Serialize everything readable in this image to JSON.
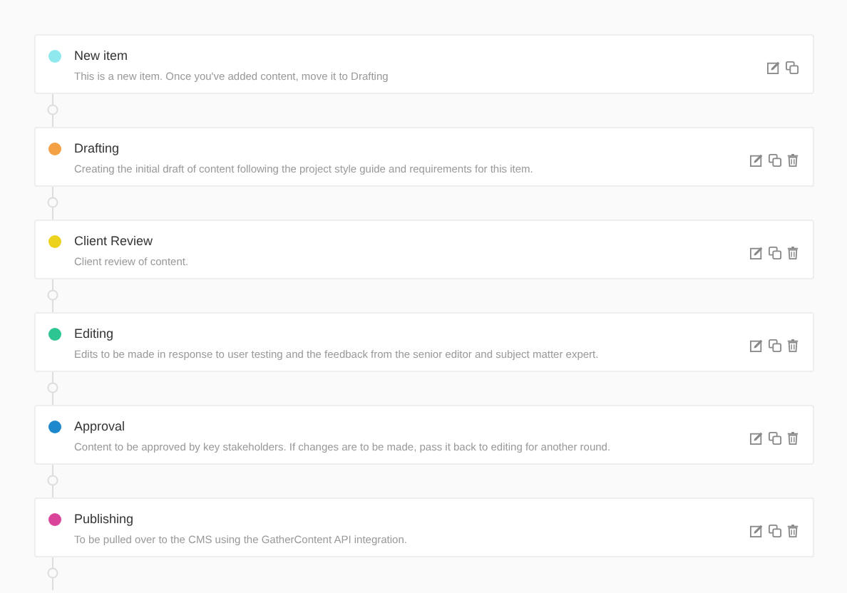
{
  "steps": [
    {
      "title": "New item",
      "description": "This is a new item. Once you've added content, move it to Drafting",
      "color": "#8ee8ee",
      "deletable": false
    },
    {
      "title": "Drafting",
      "description": "Creating the initial draft of content following the project style guide and requirements for this item.",
      "color": "#f4a044",
      "deletable": true
    },
    {
      "title": "Client Review",
      "description": "Client review of content.",
      "color": "#ecd21c",
      "deletable": true
    },
    {
      "title": "Editing",
      "description": "Edits to be made in response to user testing and the feedback from the senior editor and subject matter expert.",
      "color": "#2dc693",
      "deletable": true
    },
    {
      "title": "Approval",
      "description": "Content to be approved by key stakeholders. If changes are to be made, pass it back to editing for another round.",
      "color": "#1e88cc",
      "deletable": true
    },
    {
      "title": "Publishing",
      "description": "To be pulled over to the CMS using the GatherContent API integration.",
      "color": "#d9449a",
      "deletable": true
    }
  ]
}
